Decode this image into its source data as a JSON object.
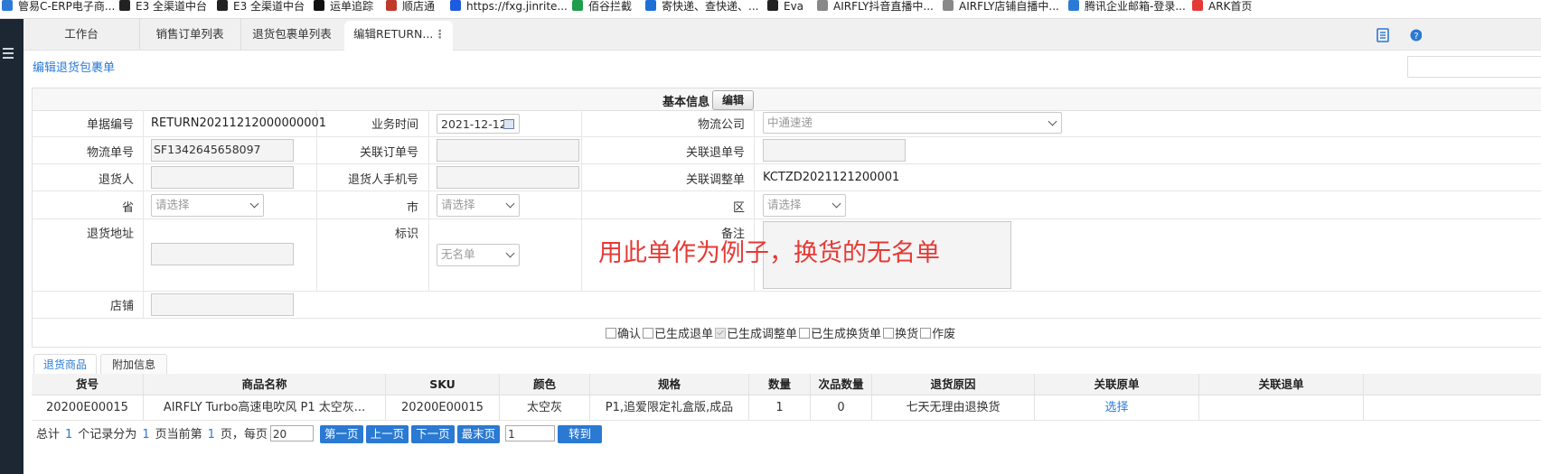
{
  "bookmarks": [
    {
      "label": "管易C-ERP电子商...",
      "icon": "edge-blue-icon",
      "color": "#2b7bd4"
    },
    {
      "label": "E3 全渠道中台",
      "icon": "crown-icon",
      "color": "#222222"
    },
    {
      "label": "E3 全渠道中台",
      "icon": "globe-icon",
      "color": "#222222"
    },
    {
      "label": "运单追踪",
      "icon": "sf-icon",
      "color": "#111111"
    },
    {
      "label": "顺店通",
      "icon": "house-icon",
      "color": "#c0392b"
    },
    {
      "label": "https://fxg.jinrite...",
      "icon": "doudian-icon",
      "color": "#1d5be0"
    },
    {
      "label": "佰谷拦截",
      "icon": "sheet-icon",
      "color": "#1e9e4a"
    },
    {
      "label": "寄快递、查快递、...",
      "icon": "swoosh-icon",
      "color": "#1d6fd8"
    },
    {
      "label": "Eva",
      "icon": "globe-icon",
      "color": "#222222"
    },
    {
      "label": "AIRFLY抖音直播中...",
      "icon": "page-icon",
      "color": "#888888"
    },
    {
      "label": "AIRFLY店铺自播中...",
      "icon": "page-icon",
      "color": "#888888"
    },
    {
      "label": "腾讯企业邮箱-登录...",
      "icon": "bowtie-icon",
      "color": "#2a7bd6"
    },
    {
      "label": "ARK首页",
      "icon": "ark-icon",
      "color": "#e53935"
    }
  ],
  "tabs": [
    {
      "label": "工作台"
    },
    {
      "label": "销售订单列表"
    },
    {
      "label": "退货包裹单列表"
    },
    {
      "label": "编辑RETURN...",
      "active": true
    }
  ],
  "breadcrumb": "编辑退货包裹单",
  "form": {
    "section_title": "基本信息",
    "edit_label": "编辑",
    "labels": {
      "doc_no": "单据编号",
      "biz_time": "业务时间",
      "logistics_company": "物流公司",
      "tracking_no": "物流单号",
      "related_order": "关联订单号",
      "related_return": "关联退单号",
      "returner": "退货人",
      "returner_phone": "退货人手机号",
      "related_adjust": "关联调整单",
      "province": "省",
      "city": "市",
      "district": "区",
      "address": "退货地址",
      "tag": "标识",
      "remark": "备注",
      "shop": "店铺"
    },
    "values": {
      "doc_no": "RETURN20211212000000001",
      "biz_time": "2021-12-12",
      "logistics_company": "中通速递",
      "tracking_no": "SF1342645658097",
      "related_order": "",
      "related_return": "",
      "returner": "",
      "returner_phone": "",
      "related_adjust": "KCTZD2021121200001",
      "province": "请选择",
      "city": "请选择",
      "district": "请选择",
      "address": "",
      "tag": "无名单",
      "remark": "",
      "shop": ""
    },
    "annotation": "用此单作为例子，换货的无名单",
    "checkboxes": [
      {
        "label": "确认",
        "checked": false
      },
      {
        "label": "已生成退单",
        "checked": false
      },
      {
        "label": "已生成调整单",
        "checked": true
      },
      {
        "label": "已生成换货单",
        "checked": false
      },
      {
        "label": "换货",
        "checked": false
      },
      {
        "label": "作废",
        "checked": false
      }
    ]
  },
  "subtabs": [
    {
      "label": "退货商品",
      "active": true
    },
    {
      "label": "附加信息"
    }
  ],
  "grid": {
    "columns": [
      "货号",
      "商品名称",
      "SKU",
      "颜色",
      "规格",
      "数量",
      "次品数量",
      "退货原因",
      "关联原单",
      "关联退单"
    ],
    "rows": [
      [
        "20200E00015",
        "AIRFLY Turbo高速电吹风 P1 太空灰...",
        "20200E00015",
        "太空灰",
        "P1,追爱限定礼盒版,成品",
        "1",
        "0",
        "七天无理由退换货",
        "选择",
        ""
      ]
    ]
  },
  "pager": {
    "t1": "总计",
    "total": "1",
    "t2": "个记录分为",
    "pages": "1",
    "t3": "页当前第",
    "current": "1",
    "t4": "页，每页",
    "page_size": "20",
    "first": "第一页",
    "prev": "上一页",
    "next": "下一页",
    "last": "最末页",
    "goto_value": "1",
    "goto": "转到"
  }
}
